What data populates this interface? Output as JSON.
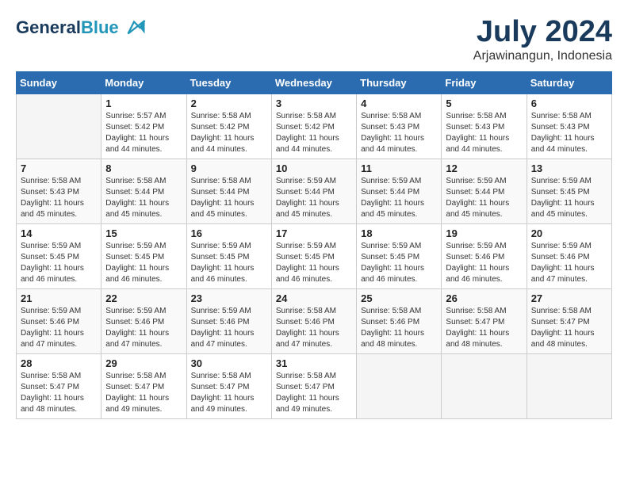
{
  "header": {
    "logo_line1": "General",
    "logo_line2": "Blue",
    "month_year": "July 2024",
    "location": "Arjawinangun, Indonesia"
  },
  "weekdays": [
    "Sunday",
    "Monday",
    "Tuesday",
    "Wednesday",
    "Thursday",
    "Friday",
    "Saturday"
  ],
  "weeks": [
    [
      {
        "day": "",
        "info": ""
      },
      {
        "day": "1",
        "info": "Sunrise: 5:57 AM\nSunset: 5:42 PM\nDaylight: 11 hours\nand 44 minutes."
      },
      {
        "day": "2",
        "info": "Sunrise: 5:58 AM\nSunset: 5:42 PM\nDaylight: 11 hours\nand 44 minutes."
      },
      {
        "day": "3",
        "info": "Sunrise: 5:58 AM\nSunset: 5:42 PM\nDaylight: 11 hours\nand 44 minutes."
      },
      {
        "day": "4",
        "info": "Sunrise: 5:58 AM\nSunset: 5:43 PM\nDaylight: 11 hours\nand 44 minutes."
      },
      {
        "day": "5",
        "info": "Sunrise: 5:58 AM\nSunset: 5:43 PM\nDaylight: 11 hours\nand 44 minutes."
      },
      {
        "day": "6",
        "info": "Sunrise: 5:58 AM\nSunset: 5:43 PM\nDaylight: 11 hours\nand 44 minutes."
      }
    ],
    [
      {
        "day": "7",
        "info": "Sunrise: 5:58 AM\nSunset: 5:43 PM\nDaylight: 11 hours\nand 45 minutes."
      },
      {
        "day": "8",
        "info": "Sunrise: 5:58 AM\nSunset: 5:44 PM\nDaylight: 11 hours\nand 45 minutes."
      },
      {
        "day": "9",
        "info": "Sunrise: 5:58 AM\nSunset: 5:44 PM\nDaylight: 11 hours\nand 45 minutes."
      },
      {
        "day": "10",
        "info": "Sunrise: 5:59 AM\nSunset: 5:44 PM\nDaylight: 11 hours\nand 45 minutes."
      },
      {
        "day": "11",
        "info": "Sunrise: 5:59 AM\nSunset: 5:44 PM\nDaylight: 11 hours\nand 45 minutes."
      },
      {
        "day": "12",
        "info": "Sunrise: 5:59 AM\nSunset: 5:44 PM\nDaylight: 11 hours\nand 45 minutes."
      },
      {
        "day": "13",
        "info": "Sunrise: 5:59 AM\nSunset: 5:45 PM\nDaylight: 11 hours\nand 45 minutes."
      }
    ],
    [
      {
        "day": "14",
        "info": "Sunrise: 5:59 AM\nSunset: 5:45 PM\nDaylight: 11 hours\nand 46 minutes."
      },
      {
        "day": "15",
        "info": "Sunrise: 5:59 AM\nSunset: 5:45 PM\nDaylight: 11 hours\nand 46 minutes."
      },
      {
        "day": "16",
        "info": "Sunrise: 5:59 AM\nSunset: 5:45 PM\nDaylight: 11 hours\nand 46 minutes."
      },
      {
        "day": "17",
        "info": "Sunrise: 5:59 AM\nSunset: 5:45 PM\nDaylight: 11 hours\nand 46 minutes."
      },
      {
        "day": "18",
        "info": "Sunrise: 5:59 AM\nSunset: 5:45 PM\nDaylight: 11 hours\nand 46 minutes."
      },
      {
        "day": "19",
        "info": "Sunrise: 5:59 AM\nSunset: 5:46 PM\nDaylight: 11 hours\nand 46 minutes."
      },
      {
        "day": "20",
        "info": "Sunrise: 5:59 AM\nSunset: 5:46 PM\nDaylight: 11 hours\nand 47 minutes."
      }
    ],
    [
      {
        "day": "21",
        "info": "Sunrise: 5:59 AM\nSunset: 5:46 PM\nDaylight: 11 hours\nand 47 minutes."
      },
      {
        "day": "22",
        "info": "Sunrise: 5:59 AM\nSunset: 5:46 PM\nDaylight: 11 hours\nand 47 minutes."
      },
      {
        "day": "23",
        "info": "Sunrise: 5:59 AM\nSunset: 5:46 PM\nDaylight: 11 hours\nand 47 minutes."
      },
      {
        "day": "24",
        "info": "Sunrise: 5:58 AM\nSunset: 5:46 PM\nDaylight: 11 hours\nand 47 minutes."
      },
      {
        "day": "25",
        "info": "Sunrise: 5:58 AM\nSunset: 5:46 PM\nDaylight: 11 hours\nand 48 minutes."
      },
      {
        "day": "26",
        "info": "Sunrise: 5:58 AM\nSunset: 5:47 PM\nDaylight: 11 hours\nand 48 minutes."
      },
      {
        "day": "27",
        "info": "Sunrise: 5:58 AM\nSunset: 5:47 PM\nDaylight: 11 hours\nand 48 minutes."
      }
    ],
    [
      {
        "day": "28",
        "info": "Sunrise: 5:58 AM\nSunset: 5:47 PM\nDaylight: 11 hours\nand 48 minutes."
      },
      {
        "day": "29",
        "info": "Sunrise: 5:58 AM\nSunset: 5:47 PM\nDaylight: 11 hours\nand 49 minutes."
      },
      {
        "day": "30",
        "info": "Sunrise: 5:58 AM\nSunset: 5:47 PM\nDaylight: 11 hours\nand 49 minutes."
      },
      {
        "day": "31",
        "info": "Sunrise: 5:58 AM\nSunset: 5:47 PM\nDaylight: 11 hours\nand 49 minutes."
      },
      {
        "day": "",
        "info": ""
      },
      {
        "day": "",
        "info": ""
      },
      {
        "day": "",
        "info": ""
      }
    ]
  ]
}
